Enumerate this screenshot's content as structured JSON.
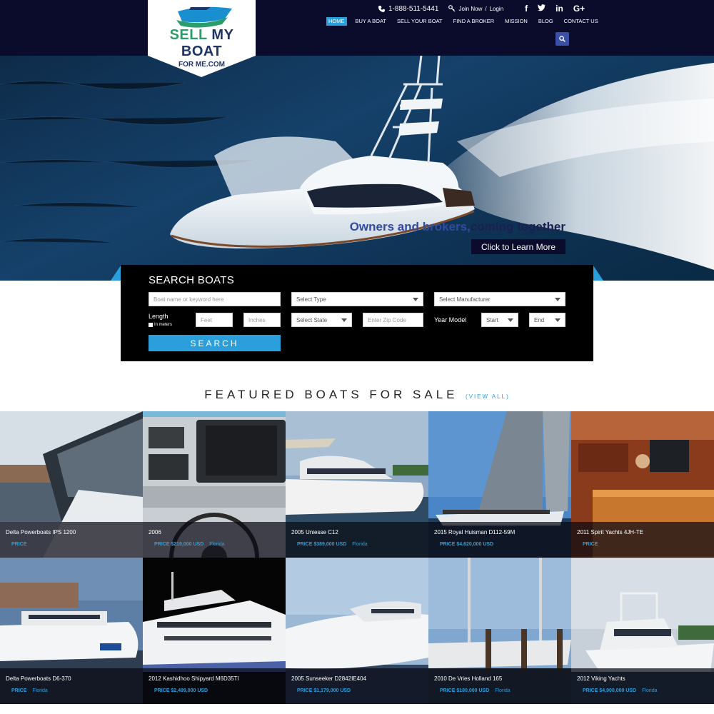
{
  "brand": {
    "name_part1": "SELL ",
    "name_part2": "MY BOAT",
    "name_sub": "FOR ME.COM"
  },
  "topbar": {
    "phone": "1-888-511-5441",
    "join": "Join Now",
    "sep": "/",
    "login": "Login",
    "socials": [
      "f",
      "t",
      "in",
      "G+"
    ]
  },
  "nav": {
    "items": [
      "HOME",
      "BUY A BOAT",
      "SELL YOUR BOAT",
      "FIND A BROKER",
      "MISSION",
      "BLOG",
      "CONTACT US"
    ],
    "active": "HOME"
  },
  "hero": {
    "tagline_blue": "Owners and brokers,",
    "tagline_dark": "coming together",
    "cta": "Click to Learn More"
  },
  "search": {
    "title": "SEARCH BOATS",
    "keyword_placeholder": "Boat name or keyword here",
    "type": "Select Type",
    "manufacturer": "Select Manufacturer",
    "length_label": "Length",
    "in_meters": "In meters",
    "feet_placeholder": "Feet",
    "inches_placeholder": "Inches",
    "state": "Select State",
    "zip_placeholder": "Enter Zip Code",
    "year_label": "Year Model",
    "start": "Start",
    "end": "End",
    "submit": "SEARCH"
  },
  "featured": {
    "title": "FEATURED BOATS FOR SALE",
    "view_all": "(VIEW ALL)",
    "boats": [
      {
        "name": "Delta Powerboats IPS 1200",
        "price": "PRICE",
        "location": ""
      },
      {
        "name": "2006",
        "price": "PRICE $219,000 USD",
        "location": "Florida"
      },
      {
        "name": "2005 Uniesse C12",
        "price": "PRICE $389,000 USD",
        "location": "Florida"
      },
      {
        "name": "2015 Royal Huisman D112-59M",
        "price": "PRICE $4,620,000 USD",
        "location": ""
      },
      {
        "name": "2011 Spirit Yachts 4JH-TE",
        "price": "PRICE",
        "location": ""
      },
      {
        "name": "Delta Powerboats D6-370",
        "price": "PRICE",
        "location": "Florida"
      },
      {
        "name": "2012 Kashidhoo Shipyard M6D35TI",
        "price": "PRICE $2,499,000 USD",
        "location": ""
      },
      {
        "name": "2005 Sunseeker D2842IE404",
        "price": "PRICE $1,179,000 USD",
        "location": ""
      },
      {
        "name": "2010 De Vries Holland 165",
        "price": "PRICE $180,000 USD",
        "location": "Florida"
      },
      {
        "name": "2012 Viking Yachts",
        "price": "PRICE $4,900,000 USD",
        "location": "Florida"
      }
    ]
  },
  "colors": {
    "header_bg": "#0b0b2c",
    "accent": "#2a9fdc",
    "brand_navy": "#1e3566",
    "brand_green": "#2a9d6a"
  }
}
